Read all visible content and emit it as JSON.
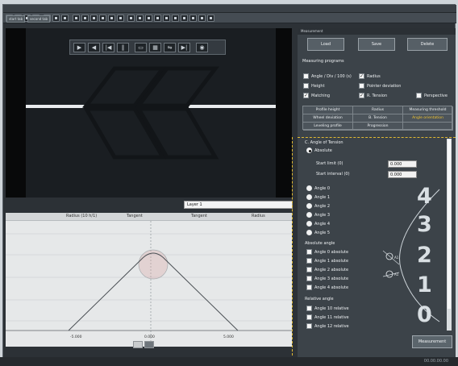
{
  "toolbar": {
    "tab1": "start tab",
    "tab2": "second tab"
  },
  "video": {
    "layer_label": "Layer 1"
  },
  "graph": {
    "headers": [
      "Radius (10 h/1)",
      "Tangent",
      "Tangent",
      "Radius"
    ],
    "x_ticks": [
      "-5.000",
      "0.000",
      "5.000"
    ]
  },
  "right": {
    "panel_title": "Measurement",
    "buttons": [
      "Load",
      "Save",
      "Delete"
    ],
    "section_title": "Measuring programs",
    "checks": [
      {
        "label": "Angle / Div / 100 (s)",
        "checked": false
      },
      {
        "label": "Radius",
        "checked": true
      },
      {
        "label": "Height",
        "checked": false
      },
      {
        "label": "Pointer deviation",
        "checked": false
      },
      {
        "label": "Matching",
        "checked": true
      },
      {
        "label": "R. Tension",
        "checked": true
      },
      {
        "label": "Perspective",
        "checked": false
      }
    ],
    "grid": [
      [
        "Profile height",
        "Radius",
        "Measuring threshold"
      ],
      [
        "Wheel deviation",
        "B. Tension",
        "Angle orientation"
      ],
      [
        "Leveling profile",
        "Progression",
        ""
      ]
    ],
    "angles_section": "C. Angle of Tension",
    "first_radio": "Absolute",
    "fields": [
      {
        "label": "Start limit (0)",
        "value": "0.000"
      },
      {
        "label": "Start interval (0)",
        "value": "0.000"
      }
    ],
    "radios": [
      "Angle 0",
      "Angle 1",
      "Angle 2",
      "Angle 3",
      "Angle 4",
      "Angle 5"
    ],
    "absolute_angle": "Absolute angle",
    "abs_items": [
      "Angle 0 absolute",
      "Angle 1 absolute",
      "Angle 2 absolute",
      "Angle 3 absolute",
      "Angle 4 absolute"
    ],
    "relative_angle": "Relative angle",
    "rel_items": [
      "Angle 10 relative",
      "Angle 11 relative",
      "Angle 12 relative"
    ],
    "measure_button": "Measurement",
    "diagram_labels": [
      "4",
      "3",
      "2",
      "1",
      "0"
    ],
    "sensor_labels": [
      "A1",
      "A1"
    ]
  },
  "status": {
    "text": "00.00.00.00"
  },
  "colors": {
    "accent": "#e1b932",
    "panel": "#3c4349"
  }
}
